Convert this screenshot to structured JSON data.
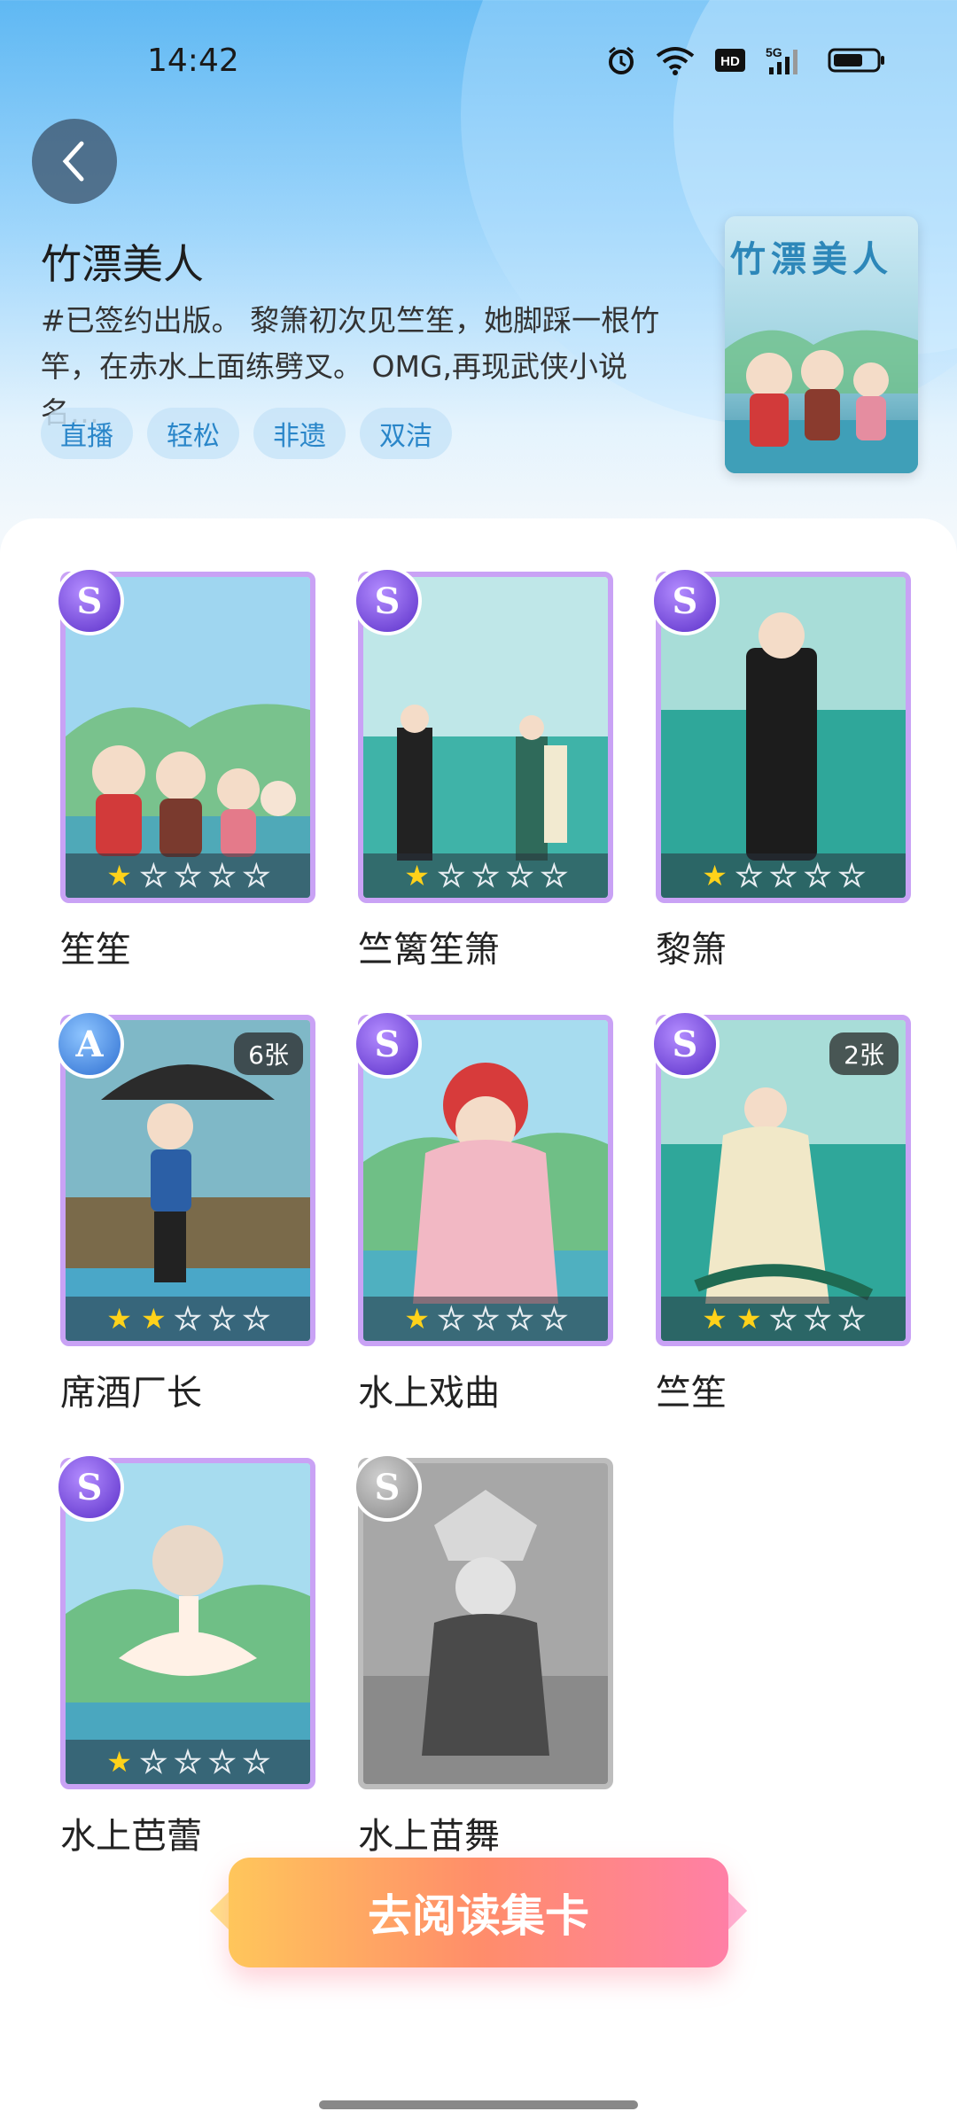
{
  "status": {
    "time": "14:42"
  },
  "book": {
    "title": "竹漂美人",
    "description": "#已签约出版。 黎箫初次见竺笙，她脚踩一根竹竿，在赤水上面练劈叉。 OMG,再现武侠小说名…",
    "tags": [
      "直播",
      "轻松",
      "非遗",
      "双洁"
    ],
    "cover_text": "竹漂美人"
  },
  "cards": [
    {
      "name": "笙笙",
      "rarity": "S",
      "stars": 1,
      "count": ""
    },
    {
      "name": "竺篱笙箫",
      "rarity": "S",
      "stars": 1,
      "count": ""
    },
    {
      "name": "黎箫",
      "rarity": "S",
      "stars": 1,
      "count": ""
    },
    {
      "name": "席酒厂长",
      "rarity": "A",
      "stars": 2,
      "count": "6张"
    },
    {
      "name": "水上戏曲",
      "rarity": "S",
      "stars": 1,
      "count": ""
    },
    {
      "name": "竺笙",
      "rarity": "S",
      "stars": 2,
      "count": "2张"
    },
    {
      "name": "水上芭蕾",
      "rarity": "S",
      "stars": 1,
      "count": ""
    },
    {
      "name": "水上苗舞",
      "rarity": "S",
      "stars": 0,
      "count": "",
      "locked": true
    }
  ],
  "cta": {
    "label": "去阅读集卡"
  }
}
